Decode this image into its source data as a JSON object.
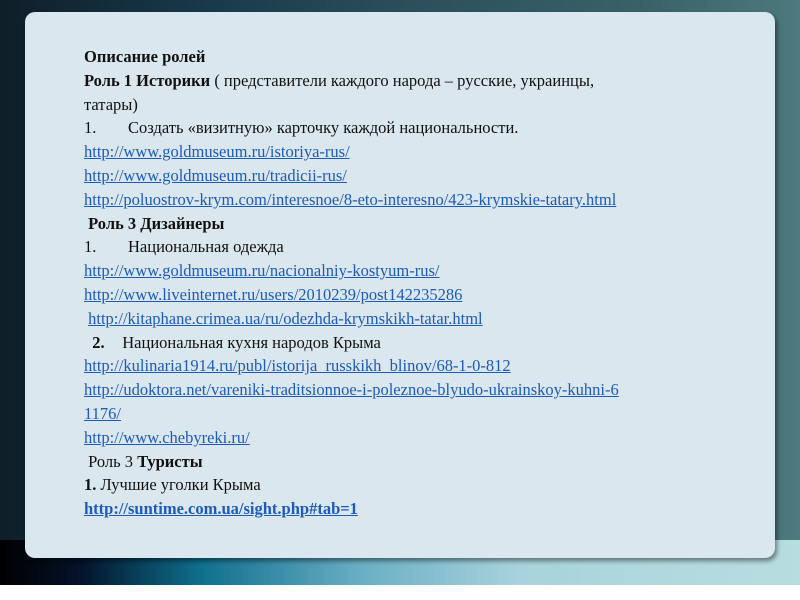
{
  "title": "Описание ролей",
  "role1": {
    "label": "Роль 1 Историки",
    "rest": " ( представители каждого народа – русские, украинцы,",
    "cont": "татары)",
    "task_num": "1.",
    "task": "Создать «визитную» карточку каждой национальности.",
    "links": [
      "http://www.goldmuseum.ru/istoriya-rus/",
      "http://www.goldmuseum.ru/tradicii-rus/",
      "http://poluostrov-krym.com/interesnoe/8-eto-interesno/423-krymskie-tatary.html"
    ]
  },
  "role3": {
    "label": "Роль 3  Дизайнеры",
    "task1_num": "1.",
    "task1": "Национальная одежда",
    "links1": [
      "http://www.goldmuseum.ru/nacionalniy-kostyum-rus/",
      "http://www.liveinternet.ru/users/2010239/post142235286",
      "http://kitaphane.crimea.ua/ru/odezhda-krymskikh-tatar.html"
    ],
    "task2_num": "2.",
    "task2": "Национальная кухня народов Крыма",
    "links2": [
      "http://kulinaria1914.ru/publ/istorija_russkikh_blinov/68-1-0-812",
      "http://udoktora.net/vareniki-traditsionnoe-i-poleznoe-blyudo-ukrainskoy-kuhni-6",
      "1176/",
      "http://www.chebyreki.ru/"
    ]
  },
  "role3b": {
    "label_plain": "Роль 3 ",
    "label_bold": "Туристы",
    "task_num": "1.",
    "task": " Лучшие уголки Крыма",
    "link": "http://suntime.com.ua/sight.php#tab=1"
  }
}
